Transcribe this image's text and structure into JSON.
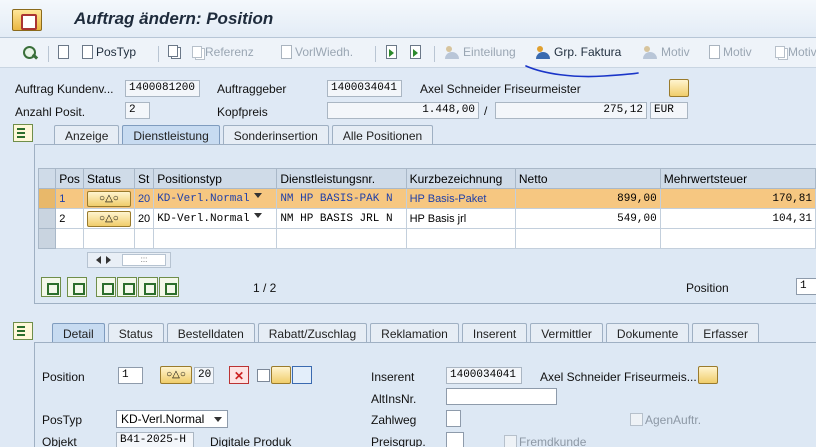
{
  "window": {
    "title": "Auftrag ändern: Position"
  },
  "toolbar": {
    "items": [
      {
        "label": "",
        "icon": "search-icon",
        "enabled": true
      },
      {
        "label": "",
        "icon": "document-icon",
        "enabled": true
      },
      {
        "label": "PosTyp",
        "icon": "document-icon",
        "enabled": true
      },
      {
        "label": "",
        "icon": "copy-icon",
        "enabled": true
      },
      {
        "label": "Referenz",
        "icon": "copy-icon",
        "enabled": false
      },
      {
        "label": "VorlWiedh.",
        "icon": "document-icon",
        "enabled": false
      },
      {
        "label": "",
        "icon": "arrow-icon",
        "enabled": true
      },
      {
        "label": "",
        "icon": "arrow-icon",
        "enabled": true
      },
      {
        "label": "Einteilung",
        "icon": "people-icon",
        "enabled": false
      },
      {
        "label": "Grp. Faktura",
        "icon": "people-icon",
        "enabled": true
      },
      {
        "label": "Motiv",
        "icon": "people-icon",
        "enabled": false
      },
      {
        "label": "Motiv",
        "icon": "document-icon",
        "enabled": false
      },
      {
        "label": "Motiv",
        "icon": "copy-icon",
        "enabled": false
      }
    ]
  },
  "header": {
    "auftrag_label": "Auftrag Kundenv...",
    "auftrag_value": "1400081200",
    "auftraggeber_label": "Auftraggeber",
    "auftraggeber_value": "1400034041",
    "auftraggeber_name": "Axel Schneider Friseurmeister",
    "anzahl_label": "Anzahl Posit.",
    "anzahl_value": "2",
    "kopfpreis_label": "Kopfpreis",
    "kopfpreis_value": "1.448,00",
    "slash": "/",
    "kopfpreis_second": "275,12",
    "currency": "EUR"
  },
  "tabs_top": [
    "Anzeige",
    "Dienstleistung",
    "Sonderinsertion",
    "Alle Positionen"
  ],
  "tabs_top_active": 1,
  "table": {
    "columns": [
      "Pos",
      "Status",
      "St",
      "Positionstyp",
      "Dienstleistungsnr.",
      "Kurzbezeichnung",
      "Netto",
      "Mehrwertsteuer"
    ],
    "rows": [
      {
        "pos": "1",
        "status": "○△○",
        "st": "20",
        "positionstyp": "KD-Verl.Normal",
        "dienstnr": "NM HP BASIS-PAK N",
        "kurz": "HP Basis-Paket",
        "netto": "899,00",
        "mwst": "170,81",
        "selected": true
      },
      {
        "pos": "2",
        "status": "○△○",
        "st": "20",
        "positionstyp": "KD-Verl.Normal",
        "dienstnr": "NM HP BASIS JRL N",
        "kurz": "HP Basis jrl",
        "netto": "549,00",
        "mwst": "104,31",
        "selected": false
      }
    ],
    "paging": "1 / 2",
    "position_label": "Position",
    "position_value": "1",
    "scroll_glyph": ":::"
  },
  "tabs_bottom": [
    "Detail",
    "Status",
    "Bestelldaten",
    "Rabatt/Zuschlag",
    "Reklamation",
    "Inserent",
    "Vermittler",
    "Dokumente",
    "Erfasser"
  ],
  "tabs_bottom_active": 0,
  "detail": {
    "position_label": "Position",
    "position_value": "1",
    "status_value": "20",
    "inserent_label": "Inserent",
    "inserent_value": "1400034041",
    "inserent_name": "Axel Schneider Friseurmeis...",
    "altins_label": "AltInsNr.",
    "altins_value": "",
    "postyp_label": "PosTyp",
    "postyp_value": "KD-Verl.Normal",
    "zahlweg_label": "Zahlweg",
    "agenauftr_label": "AgenAuftr.",
    "objekt_label": "Objekt",
    "objekt_value": "B41-2025-H",
    "objekt_text": "Digitale Produk",
    "preisgrup_label": "Preisgrup.",
    "fremdkunde_label": "Fremdkunde"
  },
  "colors": {
    "selection": "#f6c781",
    "accent": "#1f3fa8",
    "annotation": "#1a35c8"
  }
}
